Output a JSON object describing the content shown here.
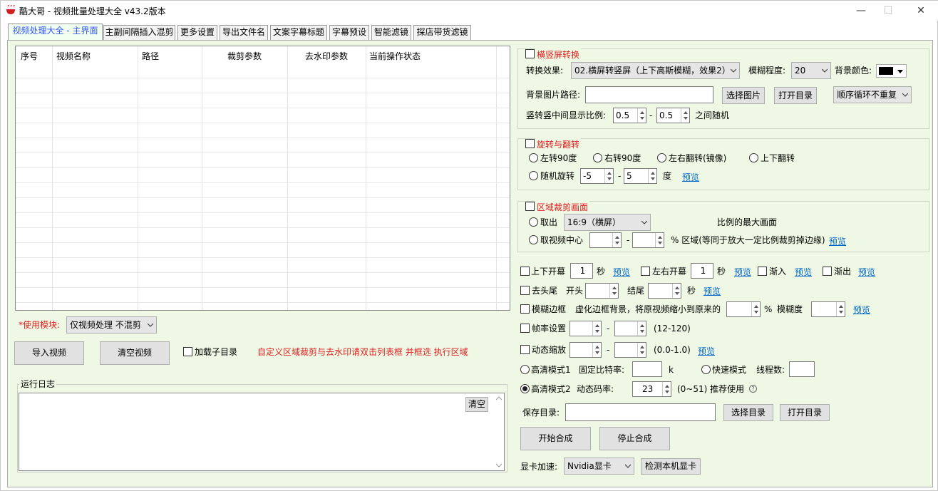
{
  "window": {
    "title": "酷大哥 -  视频批量处理大全  v43.2版本",
    "minimize": "—",
    "maximize": "☐",
    "close": "✕"
  },
  "tabs": [
    "视频处理大全 - 主界面",
    "主副间隔插入混剪",
    "更多设置",
    "导出文件名",
    "文案字幕标题",
    "字幕预设",
    "智能滤镜",
    "探店带货滤镜"
  ],
  "table": {
    "columns": [
      "序号",
      "视频名称",
      "路径",
      "裁剪参数",
      "去水印参数",
      "当前操作状态"
    ]
  },
  "left": {
    "module_label": "*使用模块:",
    "module_value": "仅视频处理 不混剪",
    "import_btn": "导入视频",
    "clear_btn": "清空视频",
    "subdir_label": "加载子目录",
    "hint": "自定义区域裁剪与去水印请双击列表框 并框选 执行区域",
    "log_title": "运行日志",
    "log_clear": "清空"
  },
  "orientation": {
    "title": "横竖屏转换",
    "effect_label": "转换效果:",
    "effect_value": "02.横屏转竖屏（上下高斯模糊，效果2）",
    "blur_label": "模糊程度:",
    "blur_value": "20",
    "bgcolor_label": "背景颜色:",
    "bgimage_label": "背景图片路径:",
    "bgimage_value": "",
    "select_image_btn": "选择图片",
    "open_dir_btn": "打开目录",
    "order_value": "顺序循环不重复",
    "ratio_label": "竖转竖中间显示比例:",
    "ratio_min": "0.5",
    "ratio_dash": "-",
    "ratio_max": "0.5",
    "ratio_suffix": "之间随机"
  },
  "rotate": {
    "title": "旋转与翻转",
    "opt_left": "左转90度",
    "opt_right": "右转90度",
    "opt_mirror": "左右翻转(镜像)",
    "opt_flip": "上下翻转",
    "opt_random": "随机旋转",
    "random_min": "-5",
    "dash": "-",
    "random_max": "5",
    "unit": "度",
    "preview": "预览"
  },
  "crop": {
    "title": "区域裁剪画面",
    "opt_take": "取出",
    "ratio_value": "16:9（横屏）",
    "ratio_suffix": "比例的最大画面",
    "opt_center": "取视频中心",
    "center_min": "",
    "dash": "-",
    "center_max": "",
    "center_suffix": "% 区域(等同于放大一定比例裁剪掉边缘)",
    "preview": "预览"
  },
  "options": {
    "open_vertical": "上下开幕",
    "open_vertical_value": "1",
    "sec": "秒",
    "preview": "预览",
    "open_horizontal": "左右开幕",
    "open_horizontal_value": "1",
    "fade_in": "渐入",
    "fade_out": "渐出",
    "trim": "去头尾",
    "trim_start": "开头",
    "trim_end": "结尾",
    "blur_border": "模糊边框",
    "blur_border_desc": "虚化边框背景，将原视频缩小到原来的",
    "percent": "%",
    "blur_degree": "模糊度",
    "fps": "帧率设置",
    "fps_dash": "-",
    "fps_range": "(12-120)",
    "zoom": "动态缩放",
    "zoom_dash": "-",
    "zoom_range": "(0.0-1.0)",
    "hq1": "高清模式1",
    "fixed_bitrate": "固定比特率:",
    "k": "k",
    "fast": "快速模式",
    "threads": "线程数:",
    "hq2": "高清模式2",
    "dyn_bitrate": "动态码率:",
    "dyn_bitrate_value": "23",
    "dyn_range": "(0~51)  推荐使用",
    "help": "?",
    "save_dir": "保存目录:",
    "select_dir": "选择目录",
    "open_dir": "打开目录",
    "start": "开始合成",
    "stop": "停止合成",
    "gpu_label": "显卡加速:",
    "gpu_value": "Nvidia显卡",
    "detect_gpu": "检测本机显卡"
  }
}
